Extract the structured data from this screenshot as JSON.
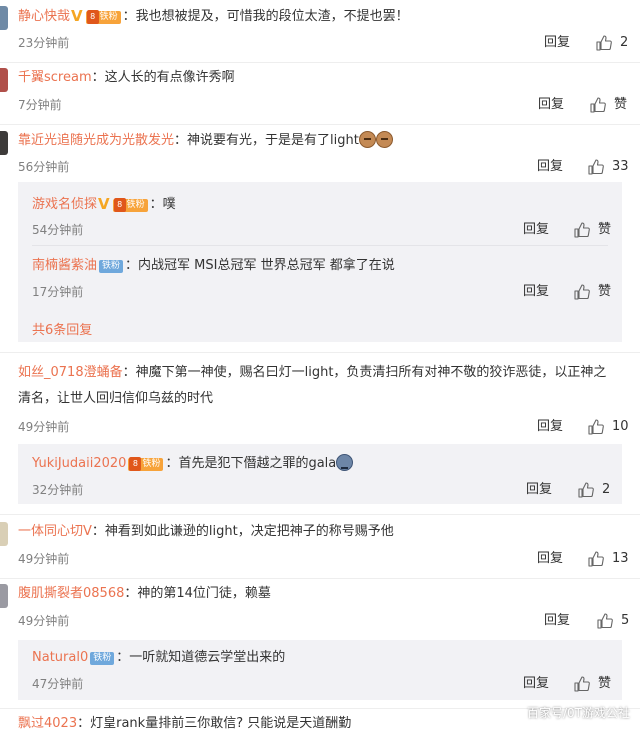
{
  "actions": {
    "reply_label": "回复",
    "like_label": "赞"
  },
  "comments": [
    {
      "user": "静心快哉",
      "colon": "：",
      "text": "我也想被提及，可惜我的段位太渣，不提也罢！",
      "time": "23分钟前",
      "likes": "2"
    },
    {
      "user": "千翼scream",
      "colon": "：",
      "text": "这人长的有点像许秀啊",
      "time": "7分钟前",
      "likes": "赞"
    },
    {
      "user": "靠近光追随光成为光散发光",
      "colon": "：",
      "text": "神说要有光，于是是有了light",
      "time": "56分钟前",
      "likes": "33",
      "replies": [
        {
          "user": "游戏名侦探",
          "colon": "：",
          "text": "噗",
          "time": "54分钟前",
          "likes": "赞"
        },
        {
          "user": "南楠酱紫油",
          "colon": "：",
          "text": "内战冠军  MSI总冠军   世界总冠军  都拿了在说",
          "time": "17分钟前",
          "likes": "赞"
        }
      ],
      "more_replies": "共6条回复"
    },
    {
      "user": "如丝_0718澄蛹备",
      "colon": "：",
      "text": "神魔下第一神使，赐名曰灯一light，负责清扫所有对神不敬的狡诈恶徒，以正神之清名，让世人回归信仰乌兹的时代",
      "time": "49分钟前",
      "likes": "10",
      "replies": [
        {
          "user": "YukiJudaii2020",
          "colon": "：",
          "text": "首先是犯下僭越之罪的gala",
          "time": "32分钟前",
          "likes": "2"
        }
      ]
    },
    {
      "user": "一体同心切V",
      "colon": "：",
      "text": "神看到如此谦逊的light，决定把神子的称号赐予他",
      "time": "49分钟前",
      "likes": "13"
    },
    {
      "user": "腹肌撕裂者08568",
      "colon": "：",
      "text": "神的第14位门徒，赖墓",
      "time": "49分钟前",
      "likes": "5",
      "replies": [
        {
          "user": "Natural0",
          "colon": "：",
          "text": "一听就知道德云学堂出来的",
          "time": "47分钟前",
          "likes": "赞"
        }
      ]
    },
    {
      "user": "飘过4023",
      "colon": "：",
      "text": "灯皇rank量排前三你敢信? 只能说是天道酬勤"
    }
  ],
  "badges": {
    "fan_label": "铁粉",
    "level_icon": "fan-level-icon",
    "verified": "V"
  },
  "icons": {
    "like": "thumbs-up-icon"
  },
  "watermark": "百家号/0T游戏公社",
  "colors": {
    "username": "#eb7350",
    "time": "#808080",
    "subbox_bg": "#f2f2f5",
    "badge_orange": "#f7a33a",
    "badge_blue": "#6fa8dc"
  }
}
